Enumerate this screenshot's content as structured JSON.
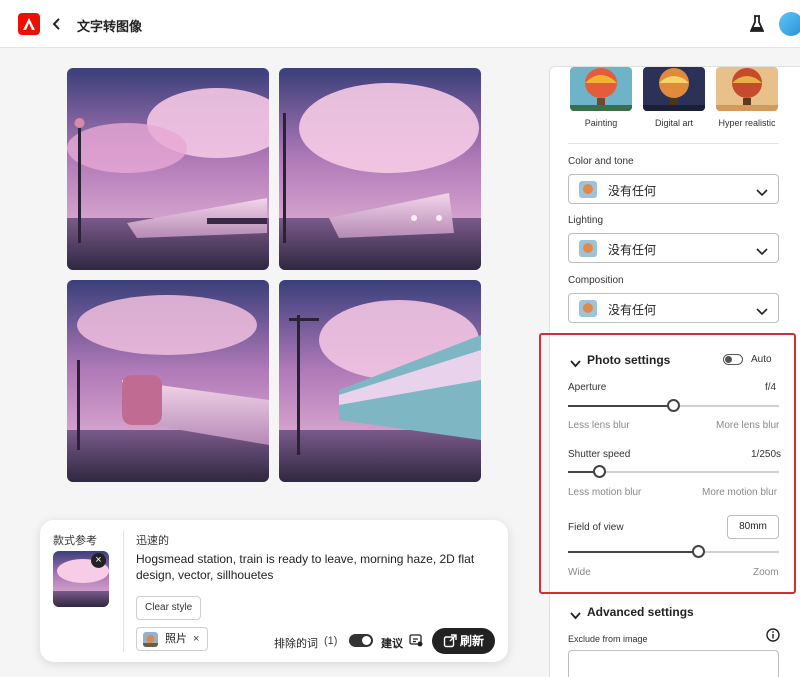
{
  "header": {
    "title": "文字转图像"
  },
  "styles": [
    {
      "label": "Painting"
    },
    {
      "label": "Digital art"
    },
    {
      "label": "Hyper realistic"
    }
  ],
  "settings": {
    "color_tone": {
      "label": "Color and tone",
      "value": "没有任何"
    },
    "lighting": {
      "label": "Lighting",
      "value": "没有任何"
    },
    "composition": {
      "label": "Composition",
      "value": "没有任何"
    }
  },
  "photo_settings": {
    "title": "Photo settings",
    "auto_label": "Auto",
    "auto_on": false,
    "aperture": {
      "label": "Aperture",
      "value": "f/4",
      "min_hint": "Less lens blur",
      "max_hint": "More lens blur",
      "level": 0.5
    },
    "shutter": {
      "label": "Shutter speed",
      "value": "1/250s",
      "min_hint": "Less motion blur",
      "max_hint": "More motion blur",
      "level": 0.15
    },
    "fov": {
      "label": "Field of view",
      "value": "80mm",
      "min_hint": "Wide",
      "max_hint": "Zoom",
      "level": 0.62
    }
  },
  "advanced": {
    "title": "Advanced settings",
    "exclude_label": "Exclude from image"
  },
  "prompt_card": {
    "style_ref_label": "款式参考",
    "fast_label": "迅速的",
    "prompt_text": "Hogsmead station, train is ready to leave, morning haze, 2D flat design, vector, sillhouetes",
    "clear_style": "Clear style",
    "chip_label": "照片",
    "chip_remove": "×",
    "exclude_label": "排除的词",
    "exclude_count": "(1)",
    "suggest_label": "建议",
    "suggest_on": true,
    "refresh_label": "刷新"
  },
  "colors": {
    "accent_red": "#d32f2f",
    "adobe_red": "#eb1000",
    "button_dark": "#222222"
  },
  "icons": [
    "adobe-logo-icon",
    "back-chevron-icon",
    "flask-icon",
    "avatar-icon",
    "chevron-down-icon",
    "close-icon",
    "info-icon",
    "refresh-icon",
    "suggestion-icon"
  ]
}
